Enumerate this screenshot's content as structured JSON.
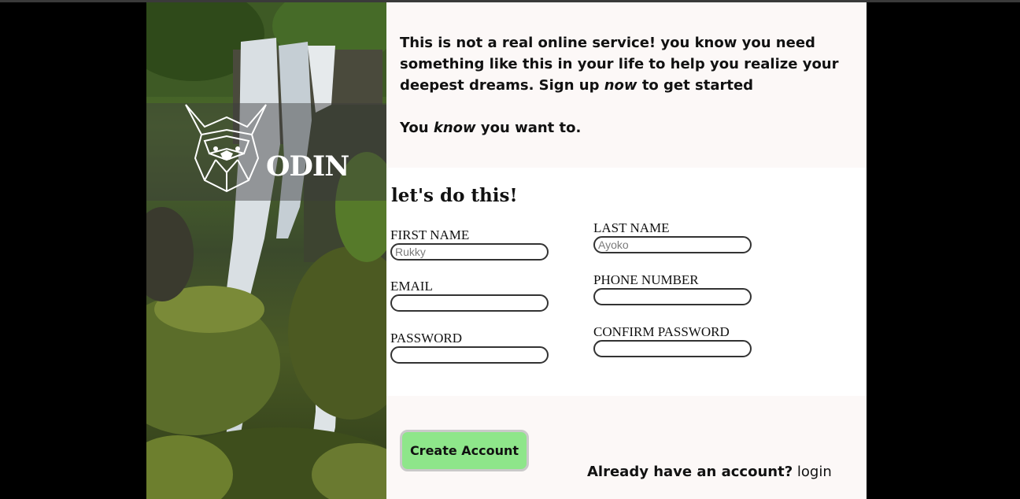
{
  "brand": {
    "name": "ODIN",
    "logo_icon": "viking-helmet-icon"
  },
  "intro": {
    "line1_start": "This is not a real online service! you know you need something like this in your life to help you realize your deepest dreams. Sign up ",
    "line1_em": "now",
    "line1_end": " to get started",
    "line2_start": "You ",
    "line2_em": "know",
    "line2_end": " you want to."
  },
  "form": {
    "title": "let's do this!",
    "fields": {
      "first_name": {
        "label": "First Name",
        "value": "",
        "placeholder": "Rukky"
      },
      "last_name": {
        "label": "Last Name",
        "value": "",
        "placeholder": "Ayoko"
      },
      "email": {
        "label": "Email",
        "value": "",
        "placeholder": ""
      },
      "phone": {
        "label": "Phone Number",
        "value": "",
        "placeholder": ""
      },
      "password": {
        "label": "Password",
        "value": "",
        "placeholder": ""
      },
      "confirm_password": {
        "label": "Confirm Password",
        "value": "",
        "placeholder": ""
      }
    }
  },
  "footer": {
    "create_button": "Create Account",
    "login_prompt": "Already have an account?",
    "login_link": "login"
  },
  "colors": {
    "page_bg": "#000000",
    "panel_bg": "#fcf8f7",
    "button_bg": "#8ee68a"
  }
}
